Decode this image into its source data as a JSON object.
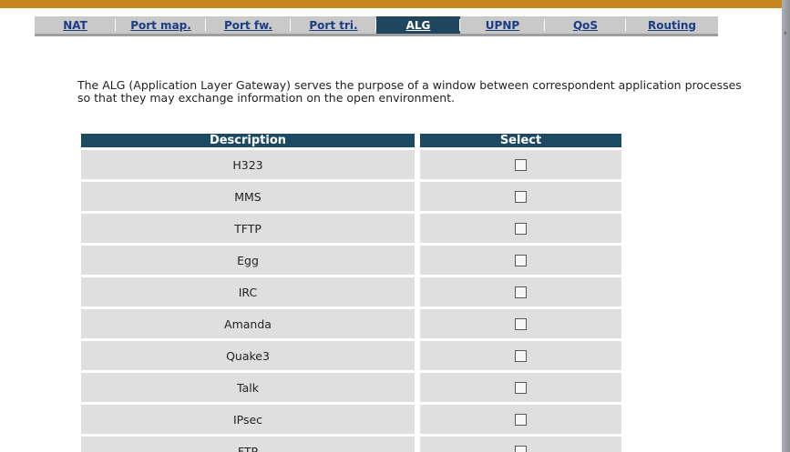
{
  "tabs": [
    {
      "label": "NAT",
      "active": false
    },
    {
      "label": "Port map.",
      "active": false
    },
    {
      "label": "Port fw.",
      "active": false
    },
    {
      "label": "Port tri.",
      "active": false
    },
    {
      "label": "ALG",
      "active": true
    },
    {
      "label": "UPNP",
      "active": false
    },
    {
      "label": "QoS",
      "active": false
    },
    {
      "label": "Routing",
      "active": false
    }
  ],
  "intro_text": "The ALG (Application Layer Gateway) serves the purpose of a window between correspondent application processes so that they may exchange information on the open environment.",
  "table": {
    "headers": {
      "description": "Description",
      "select": "Select"
    },
    "rows": [
      {
        "description": "H323",
        "selected": false
      },
      {
        "description": "MMS",
        "selected": false
      },
      {
        "description": "TFTP",
        "selected": false
      },
      {
        "description": "Egg",
        "selected": false
      },
      {
        "description": "IRC",
        "selected": false
      },
      {
        "description": "Amanda",
        "selected": false
      },
      {
        "description": "Quake3",
        "selected": false
      },
      {
        "description": "Talk",
        "selected": false
      },
      {
        "description": "IPsec",
        "selected": false
      },
      {
        "description": "FTP",
        "selected": false
      }
    ]
  },
  "colors": {
    "top_bar": "#c8861e",
    "tab_active_bg": "#1f465e",
    "table_header_bg": "#1d4a63",
    "row_bg": "#dfdfdf"
  }
}
